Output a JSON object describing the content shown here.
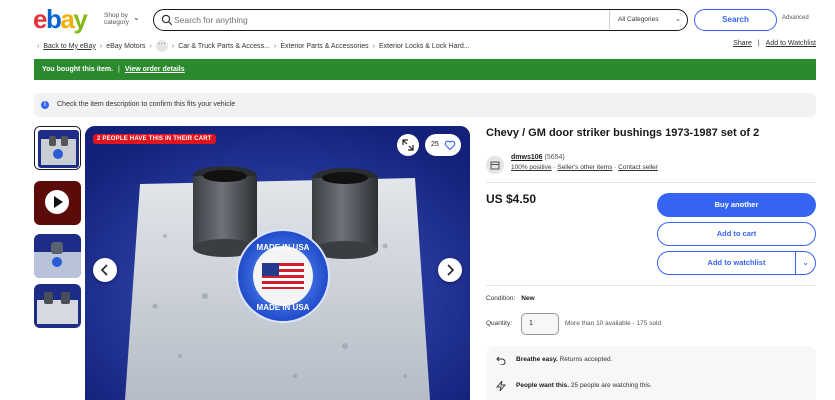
{
  "header": {
    "logo": [
      "e",
      "b",
      "a",
      "y"
    ],
    "shop_by_category": [
      "Shop by",
      "category"
    ],
    "search_placeholder": "Search for anything",
    "category_select": "All Categories",
    "search_button": "Search",
    "advanced": "Advanced"
  },
  "breadcrumb": {
    "back": "Back to My eBay",
    "items": [
      "eBay Motors",
      "Car & Truck Parts & Access...",
      "Exterior Parts & Accessories",
      "Exterior Locks & Lock Hard..."
    ],
    "more": "···"
  },
  "actions": {
    "share": "Share",
    "watchlist": "Add to Watchlist"
  },
  "purchase_banner": {
    "message": "You bought this item.",
    "separator": "|",
    "link": "View order details",
    "color": "#2b8a2e"
  },
  "fitment_notice": {
    "icon": "i",
    "text": "Check the item description to confirm this fits your vehicle"
  },
  "gallery": {
    "badge": "2 PEOPLE HAVE THIS IN THEIR CART",
    "watch_count": "25",
    "logo_text_top": "MADE IN USA",
    "logo_text_bottom": "MADE IN USA"
  },
  "item": {
    "title": "Chevy / GM door striker bushings 1973-1987 set of 2",
    "seller": {
      "name": "dmws106",
      "feedback": "(5654)",
      "positive": "100% positive",
      "other_items": "Seller's other items",
      "contact": "Contact seller"
    },
    "price": "US $4.50",
    "buy_button": "Buy another",
    "cart_button": "Add to cart",
    "watch_button": "Add to watchlist",
    "condition_label": "Condition:",
    "condition_value": "New",
    "quantity_label": "Quantity:",
    "quantity_value": "1",
    "availability": "More than 10 available · 175 sold",
    "perks": [
      {
        "title": "Breathe easy.",
        "text": "Returns accepted."
      },
      {
        "title": "People want this.",
        "text": "25 people are watching this."
      }
    ],
    "accent_color": "#3665f3"
  }
}
